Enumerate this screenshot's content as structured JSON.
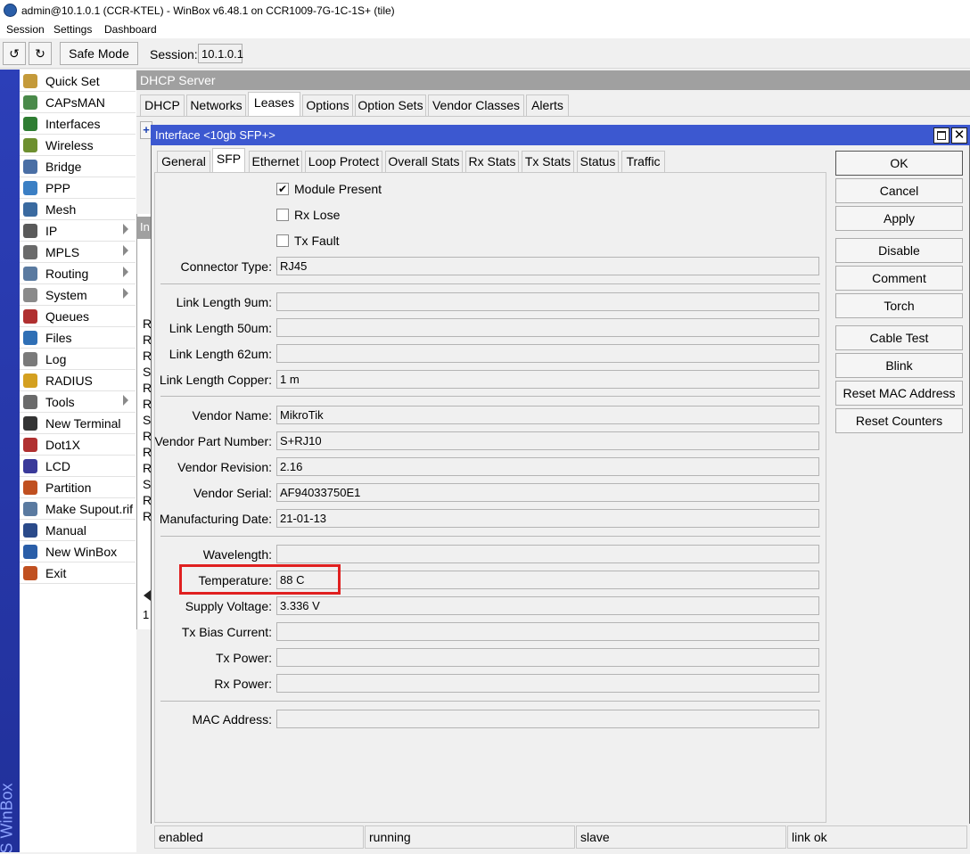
{
  "app": {
    "title": "admin@10.1.0.1 (CCR-KTEL) - WinBox v6.48.1 on CCR1009-7G-1C-1S+ (tile)",
    "menu": [
      "Session",
      "Settings",
      "Dashboard"
    ]
  },
  "toolbar": {
    "undo_icon": "undo-icon",
    "redo_icon": "redo-icon",
    "safe_mode_label": "Safe Mode",
    "session_label": "Session:",
    "session_value": "10.1.0.1"
  },
  "sidebar": {
    "brand": "S WinBox",
    "items": [
      {
        "label": "Quick Set",
        "icon": "wand-icon",
        "submenu": false
      },
      {
        "label": "CAPsMAN",
        "icon": "antenna-icon",
        "submenu": false
      },
      {
        "label": "Interfaces",
        "icon": "interfaces-icon",
        "submenu": false
      },
      {
        "label": "Wireless",
        "icon": "wireless-icon",
        "submenu": false
      },
      {
        "label": "Bridge",
        "icon": "bridge-icon",
        "submenu": false
      },
      {
        "label": "PPP",
        "icon": "ppp-icon",
        "submenu": false
      },
      {
        "label": "Mesh",
        "icon": "mesh-icon",
        "submenu": false
      },
      {
        "label": "IP",
        "icon": "ip-icon",
        "submenu": true
      },
      {
        "label": "MPLS",
        "icon": "mpls-icon",
        "submenu": true
      },
      {
        "label": "Routing",
        "icon": "routing-icon",
        "submenu": true
      },
      {
        "label": "System",
        "icon": "system-icon",
        "submenu": true
      },
      {
        "label": "Queues",
        "icon": "queues-icon",
        "submenu": false
      },
      {
        "label": "Files",
        "icon": "files-icon",
        "submenu": false
      },
      {
        "label": "Log",
        "icon": "log-icon",
        "submenu": false
      },
      {
        "label": "RADIUS",
        "icon": "radius-icon",
        "submenu": false
      },
      {
        "label": "Tools",
        "icon": "tools-icon",
        "submenu": true
      },
      {
        "label": "New Terminal",
        "icon": "terminal-icon",
        "submenu": false
      },
      {
        "label": "Dot1X",
        "icon": "dot1x-icon",
        "submenu": false
      },
      {
        "label": "LCD",
        "icon": "lcd-icon",
        "submenu": false
      },
      {
        "label": "Partition",
        "icon": "partition-icon",
        "submenu": false
      },
      {
        "label": "Make Supout.rif",
        "icon": "supout-icon",
        "submenu": false
      },
      {
        "label": "Manual",
        "icon": "manual-icon",
        "submenu": false
      },
      {
        "label": "New WinBox",
        "icon": "winbox-icon",
        "submenu": false
      },
      {
        "label": "Exit",
        "icon": "exit-icon",
        "submenu": false
      }
    ]
  },
  "dhcp": {
    "title": "DHCP Server",
    "tabs": [
      "DHCP",
      "Networks",
      "Leases",
      "Options",
      "Option Sets",
      "Vendor Classes",
      "Alerts"
    ],
    "active_tab": "Leases"
  },
  "background_list": {
    "header_fragment": "In",
    "row_letters": [
      "R",
      "R",
      "R",
      "S",
      "R",
      "R",
      "S",
      "R",
      "R",
      "R",
      "S",
      "R",
      "R"
    ],
    "footer_fragment": "1"
  },
  "interface_window": {
    "title": "Interface <10gb SFP+>",
    "tabs": [
      "General",
      "SFP",
      "Ethernet",
      "Loop Protect",
      "Overall Stats",
      "Rx Stats",
      "Tx Stats",
      "Status",
      "Traffic"
    ],
    "active_tab": "SFP",
    "checkboxes": [
      {
        "label": "Module Present",
        "checked": true
      },
      {
        "label": "Rx Lose",
        "checked": false
      },
      {
        "label": "Tx Fault",
        "checked": false
      }
    ],
    "fields": {
      "connector_type": {
        "label": "Connector Type:",
        "value": "RJ45"
      },
      "link_length_9um": {
        "label": "Link Length 9um:",
        "value": ""
      },
      "link_length_50um": {
        "label": "Link Length 50um:",
        "value": ""
      },
      "link_length_62um": {
        "label": "Link Length 62um:",
        "value": ""
      },
      "link_length_copper": {
        "label": "Link Length Copper:",
        "value": "1 m"
      },
      "vendor_name": {
        "label": "Vendor Name:",
        "value": "MikroTik"
      },
      "vendor_part_number": {
        "label": "Vendor Part Number:",
        "value": "S+RJ10"
      },
      "vendor_revision": {
        "label": "Vendor Revision:",
        "value": "2.16"
      },
      "vendor_serial": {
        "label": "Vendor Serial:",
        "value": "AF94033750E1"
      },
      "manufacturing_date": {
        "label": "Manufacturing Date:",
        "value": "21-01-13"
      },
      "wavelength": {
        "label": "Wavelength:",
        "value": ""
      },
      "temperature": {
        "label": "Temperature:",
        "value": "88 C"
      },
      "supply_voltage": {
        "label": "Supply Voltage:",
        "value": "3.336 V"
      },
      "tx_bias_current": {
        "label": "Tx Bias Current:",
        "value": ""
      },
      "tx_power": {
        "label": "Tx Power:",
        "value": ""
      },
      "rx_power": {
        "label": "Rx Power:",
        "value": ""
      },
      "mac_address": {
        "label": "MAC Address:",
        "value": ""
      }
    },
    "buttons": [
      "OK",
      "Cancel",
      "Apply",
      "Disable",
      "Comment",
      "Torch",
      "Cable Test",
      "Blink",
      "Reset MAC Address",
      "Reset Counters"
    ],
    "status": [
      "enabled",
      "running",
      "slave",
      "link ok"
    ]
  },
  "colors": {
    "window_title_bg": "#3c58d0",
    "sidebar_band": "#2c3fb8",
    "highlight": "#e02020"
  }
}
